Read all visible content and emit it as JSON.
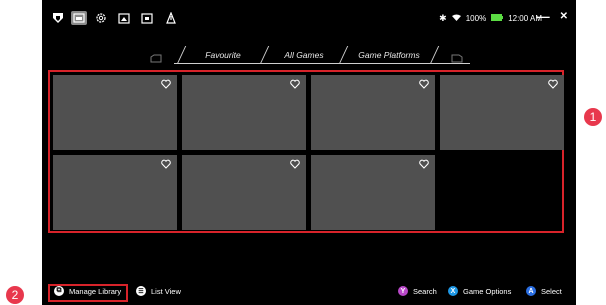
{
  "topbar": {
    "icons": [
      "logo-icon",
      "library-icon",
      "settings-icon",
      "media-icon",
      "screen-icon",
      "power-icon"
    ],
    "status": {
      "battery_percent": "100%",
      "time": "12:00 AM"
    },
    "minimize": "—",
    "close": "✕"
  },
  "tabs": [
    "Favourite",
    "All Games",
    "Game Platforms"
  ],
  "games": [
    {
      "favorite": false
    },
    {
      "favorite": false
    },
    {
      "favorite": false
    },
    {
      "favorite": false
    },
    {
      "favorite": false
    },
    {
      "favorite": false
    },
    {
      "favorite": false
    }
  ],
  "bottombar": {
    "manage_library": "Manage Library",
    "list_view": "List View",
    "search": "Search",
    "game_options": "Game Options",
    "select": "Select",
    "btn_y": "Y",
    "btn_x": "X",
    "btn_a": "A"
  },
  "callouts": {
    "grid": "1",
    "manage": "2"
  },
  "colors": {
    "highlight": "#d8232a",
    "callout": "#e8384d",
    "y_button": "#b948c9",
    "x_button": "#1e98e6",
    "a_button": "#2b6fe3",
    "battery": "#5bdc43"
  }
}
